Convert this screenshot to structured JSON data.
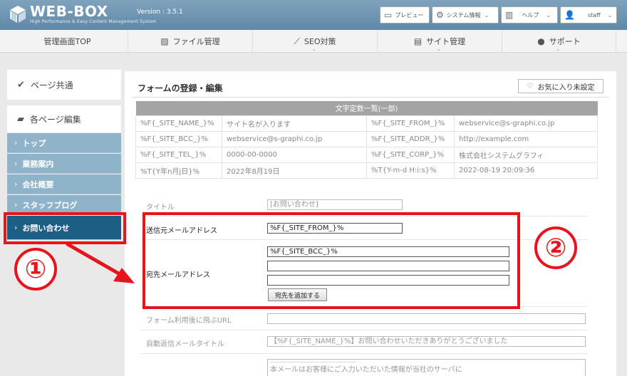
{
  "header": {
    "brand_title": "WEB-BOX",
    "brand_sub": "High Performance & Easy Content Management System",
    "version": "Version : 3.5.1",
    "preview_label": "プレビュー",
    "system_label": "システム情報",
    "help_label": "ヘルプ",
    "user_label": "staff"
  },
  "nav": {
    "items": [
      {
        "label": "管理画面TOP",
        "icon": "home"
      },
      {
        "label": "ファイル管理",
        "icon": "image-icon"
      },
      {
        "label": "SEO対策",
        "icon": "chart-icon"
      },
      {
        "label": "サイト管理",
        "icon": "gear-doc-icon"
      },
      {
        "label": "サポート",
        "icon": "chat-icon"
      }
    ]
  },
  "sidebar": {
    "common_label": "ページ共通",
    "pages_label": "各ページ編集",
    "items": [
      {
        "label": "トップ"
      },
      {
        "label": "業務案内"
      },
      {
        "label": "会社概要"
      },
      {
        "label": "スタッフブログ"
      },
      {
        "label": "お問い合わせ"
      }
    ]
  },
  "main": {
    "title": "フォームの登録・編集",
    "fav_label": "お気に入り未設定",
    "table_title": "文字定数一覧(一部)",
    "rows": [
      [
        "%F{_SITE_NAME_}%",
        "サイト名が入ります",
        "%F{_SITE_FROM_}%",
        "webservice@s-graphi.co.jp"
      ],
      [
        "%F{_SITE_BCC_}%",
        "webservice@s-graphi.co.jp",
        "%F{_SITE_ADDR_}%",
        "http://example.com"
      ],
      [
        "%F{_SITE_TEL_}%",
        "0000-00-0000",
        "%F{_SITE_CORP_}%",
        "株式会社システムグラフィ"
      ],
      [
        "%T{Y年n月j日}%",
        "2022年8月19日",
        "%T{Y-m-d H:i:s}%",
        "2022-08-19 20:09:36"
      ]
    ],
    "form": {
      "title_label": "タイトル",
      "title_value": "[お問い合わせ]",
      "from_label": "送信元メールアドレス",
      "from_value": "%F{_SITE_FROM_}%",
      "to_label": "宛先メールアドレス",
      "to_value_1": "%F{_SITE_BCC_}%",
      "to_value_2": "",
      "to_value_3": "",
      "add_button": "宛先を追加する",
      "redirect_label": "フォーム利用後に飛ぶURL",
      "redirect_value": "",
      "auto_title_label": "自動返信メールタイトル",
      "auto_title_value": "【%F{_SITE_NAME_}%】お問い合わせいただきありがとうございました",
      "body_line1": "--------------------------------------------------------",
      "body_line2": "本メールはお客様にご入力いただいた情報が当社のサーバに"
    }
  },
  "annotations": {
    "marker1": "①",
    "marker2": "②",
    "color": "#e8141c"
  }
}
